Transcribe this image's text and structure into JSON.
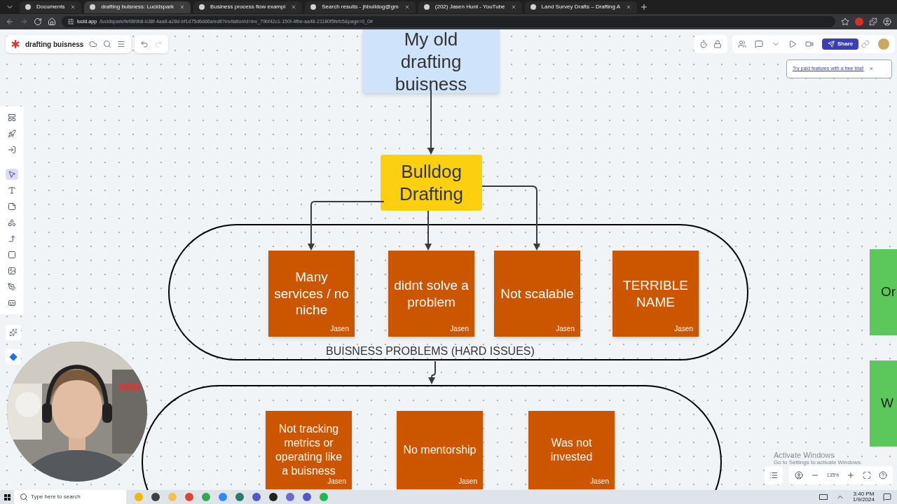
{
  "browser": {
    "tabs": [
      {
        "title": "Documents",
        "selected": false
      },
      {
        "title": "drafting buisness: Lucidspark",
        "selected": true
      },
      {
        "title": "Business process flow exampl",
        "selected": false
      },
      {
        "title": "Search results - jhbulldog@gm",
        "selected": false
      },
      {
        "title": "(202) Jasen Hunt - YouTube",
        "selected": false
      },
      {
        "title": "Land Survey Drafts – Drafting A",
        "selected": false
      }
    ],
    "address": {
      "host": "lucid.app",
      "path": "/lucidspark/fef989b8-b38f-4aa8-a28d-bf1d75d6dd6a/edit?invitationId=inv_79bf42c1-150f-4fbe-aa48-21180f5fefc5&page=0_0#"
    }
  },
  "app": {
    "document_title": "drafting buisness",
    "share": "Share",
    "trial_banner": "Try paid features with a free trial!",
    "close": "×",
    "zoom": "135%",
    "tools": [
      {
        "selected": false
      },
      {
        "selected": false
      },
      {
        "selected": false
      },
      {
        "selected": true
      },
      {
        "selected": false
      },
      {
        "selected": false
      },
      {
        "selected": false
      },
      {
        "selected": false
      },
      {
        "selected": false
      },
      {
        "selected": false
      },
      {
        "selected": false
      },
      {
        "selected": false
      }
    ]
  },
  "canvas": {
    "title_note": "My old drafting buisness",
    "main_node": "Bulldog Drafting",
    "group_label": "BUISNESS PROBLEMS (HARD ISSUES)",
    "problems": [
      {
        "text": "Many services / no niche",
        "author": "Jasen"
      },
      {
        "text": "didnt solve a problem",
        "author": "Jasen"
      },
      {
        "text": "Not scalable",
        "author": "Jasen"
      },
      {
        "text": "TERRIBLE NAME",
        "author": "Jasen"
      }
    ],
    "problems_2": [
      {
        "text": "Not tracking metrics or operating like a buisness",
        "author": "Jasen"
      },
      {
        "text": "No mentorship",
        "author": "Jasen"
      },
      {
        "text": "Was not invested",
        "author": "Jasen"
      }
    ],
    "side_notes": [
      "Or",
      "W"
    ]
  },
  "windows": {
    "activate_title": "Activate Windows",
    "activate_hint": "Go to Settings to activate Windows.",
    "search_placeholder": "Type here to search",
    "time": "3:40 PM",
    "date": "1/9/2024"
  }
}
